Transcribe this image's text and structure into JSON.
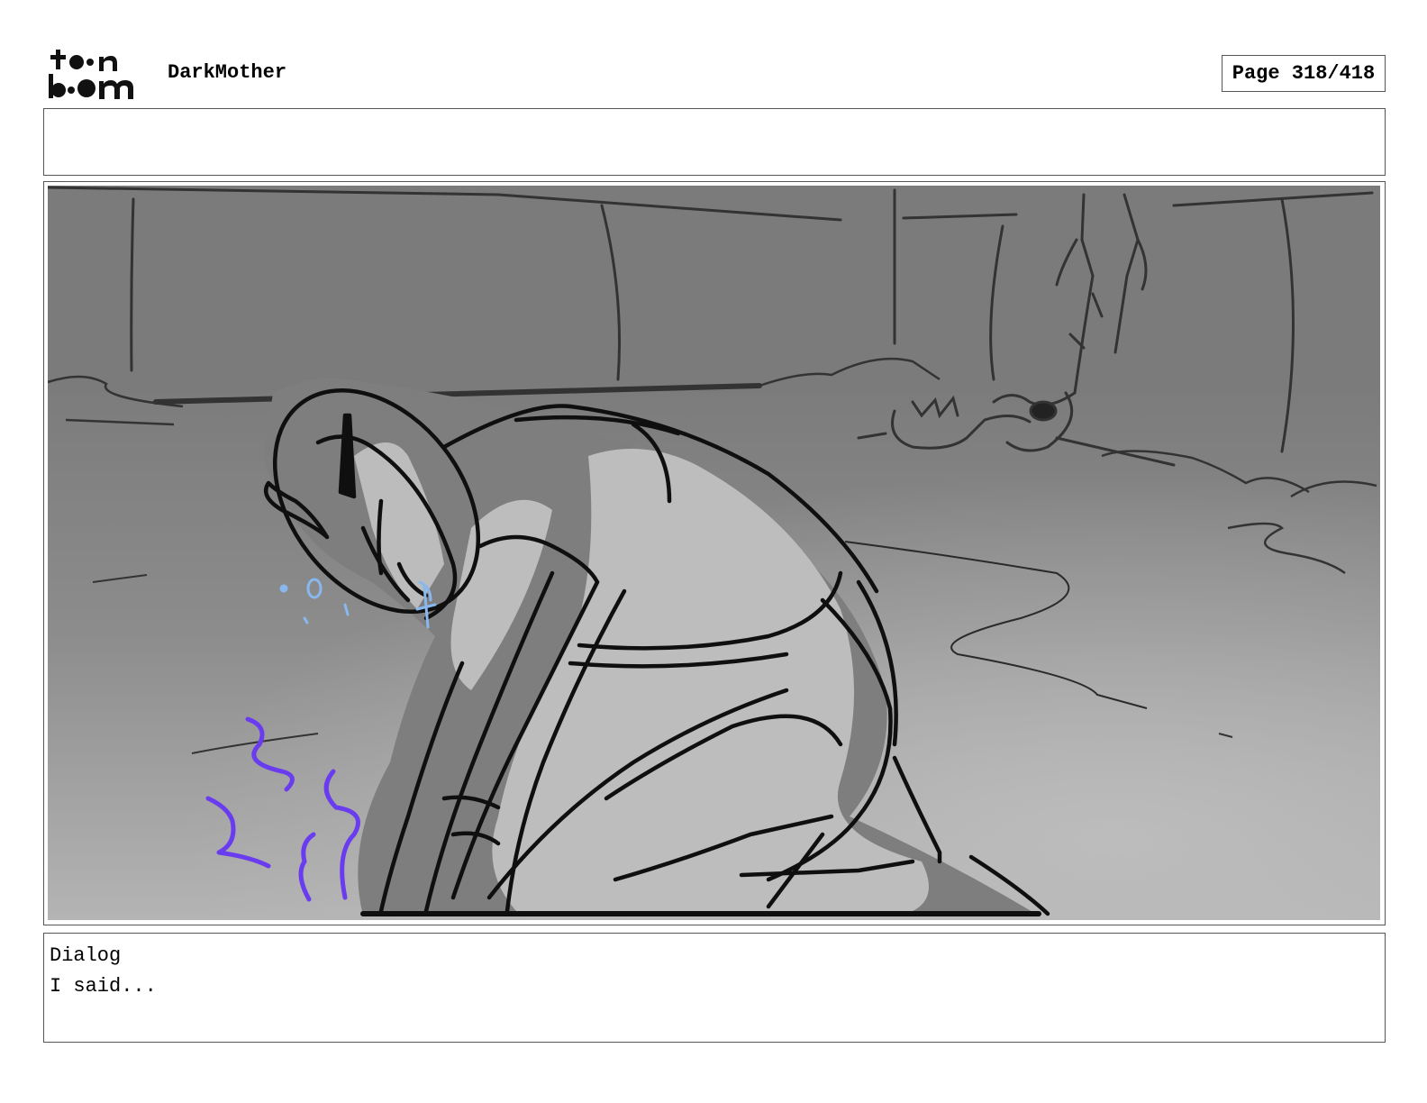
{
  "header": {
    "logo_text": "toon boom",
    "project_title": "DarkMother",
    "page_indicator": "Page 318/418"
  },
  "notes": {
    "text": ""
  },
  "panel": {
    "image": "storyboard-sketch",
    "colors": {
      "background_dark": "#7d7d7d",
      "background_light": "#b0b0b0",
      "figure_fill": "#bdbdbd",
      "line": "#111111",
      "tears": "#88b8ee",
      "magic_zigzag": "#6a3cf0"
    }
  },
  "dialog": {
    "label": "Dialog",
    "text": "I said..."
  }
}
